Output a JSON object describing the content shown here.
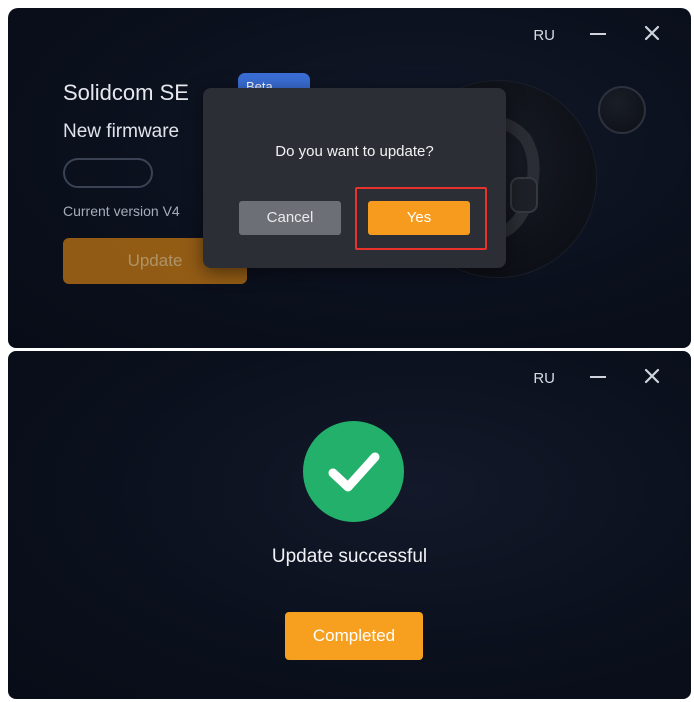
{
  "top_window": {
    "language": "RU",
    "device_name": "Solidcom SE",
    "badge": "Beta",
    "new_firmware_label": "New firmware",
    "current_version_label": "Current version V4",
    "update_button": "Update",
    "dialog": {
      "message": "Do you want to update?",
      "cancel_label": "Cancel",
      "yes_label": "Yes"
    }
  },
  "bottom_window": {
    "language": "RU",
    "status_text": "Update successful",
    "completed_button": "Completed"
  },
  "icons": {
    "minimize": "minimize-icon",
    "close": "close-icon",
    "success": "checkmark-icon"
  },
  "colors": {
    "accent_orange": "#f69b1d",
    "success_green": "#22b06a",
    "highlight_red": "#e7332c",
    "badge_blue": "#3a6ed6",
    "background": "#0b101d"
  }
}
